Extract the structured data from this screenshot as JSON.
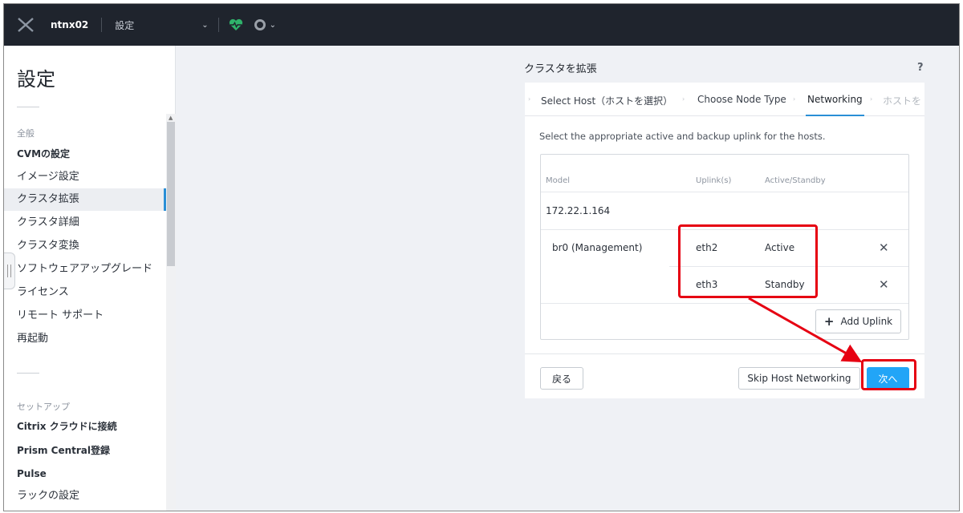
{
  "topbar": {
    "cluster_name": "ntnx02",
    "section": "設定",
    "chevron": "⌄"
  },
  "sidebar": {
    "title": "設定",
    "section_general": "全般",
    "items_general": [
      {
        "label": "CVMの設定"
      },
      {
        "label": "イメージ設定"
      },
      {
        "label": "クラスタ拡張"
      },
      {
        "label": "クラスタ詳細"
      },
      {
        "label": "クラスタ変換"
      },
      {
        "label": "ソフトウェアアップグレード"
      },
      {
        "label": "ライセンス"
      },
      {
        "label": "リモート サポート"
      },
      {
        "label": "再起動"
      }
    ],
    "section_setup": "セットアップ",
    "items_setup": [
      {
        "label": "Citrix クラウドに接続"
      },
      {
        "label": "Prism Central登録"
      },
      {
        "label": "Pulse"
      },
      {
        "label": "ラックの設定"
      }
    ],
    "active_item": "クラスタ拡張"
  },
  "panel": {
    "title": "クラスタを拡張",
    "help": "?",
    "tabs": [
      {
        "label": "Select Host（ホストを選択）"
      },
      {
        "label": "Choose Node Type"
      },
      {
        "label": "Networking"
      },
      {
        "label": "ホストを"
      }
    ],
    "active_tab": "Networking",
    "instruction": "Select the appropriate active and backup uplink for the hosts.",
    "table": {
      "headers": {
        "model": "Model",
        "uplinks": "Uplink(s)",
        "active_standby": "Active/Standby"
      },
      "host_ip": "172.22.1.164",
      "bridge": "br0 (Management)",
      "rows": [
        {
          "uplink": "eth2",
          "mode": "Active",
          "remove": "✕"
        },
        {
          "uplink": "eth3",
          "mode": "Standby",
          "remove": "✕"
        }
      ],
      "add_uplink": "Add Uplink",
      "add_icon": "+"
    },
    "footer": {
      "back": "戻る",
      "skip": "Skip Host Networking",
      "next": "次へ"
    }
  },
  "colors": {
    "topbar_bg": "#1f242d",
    "accent": "#2a8fd6",
    "primary_button": "#22a5f7",
    "health": "#2fb36b",
    "annotation_red": "#e60012"
  }
}
